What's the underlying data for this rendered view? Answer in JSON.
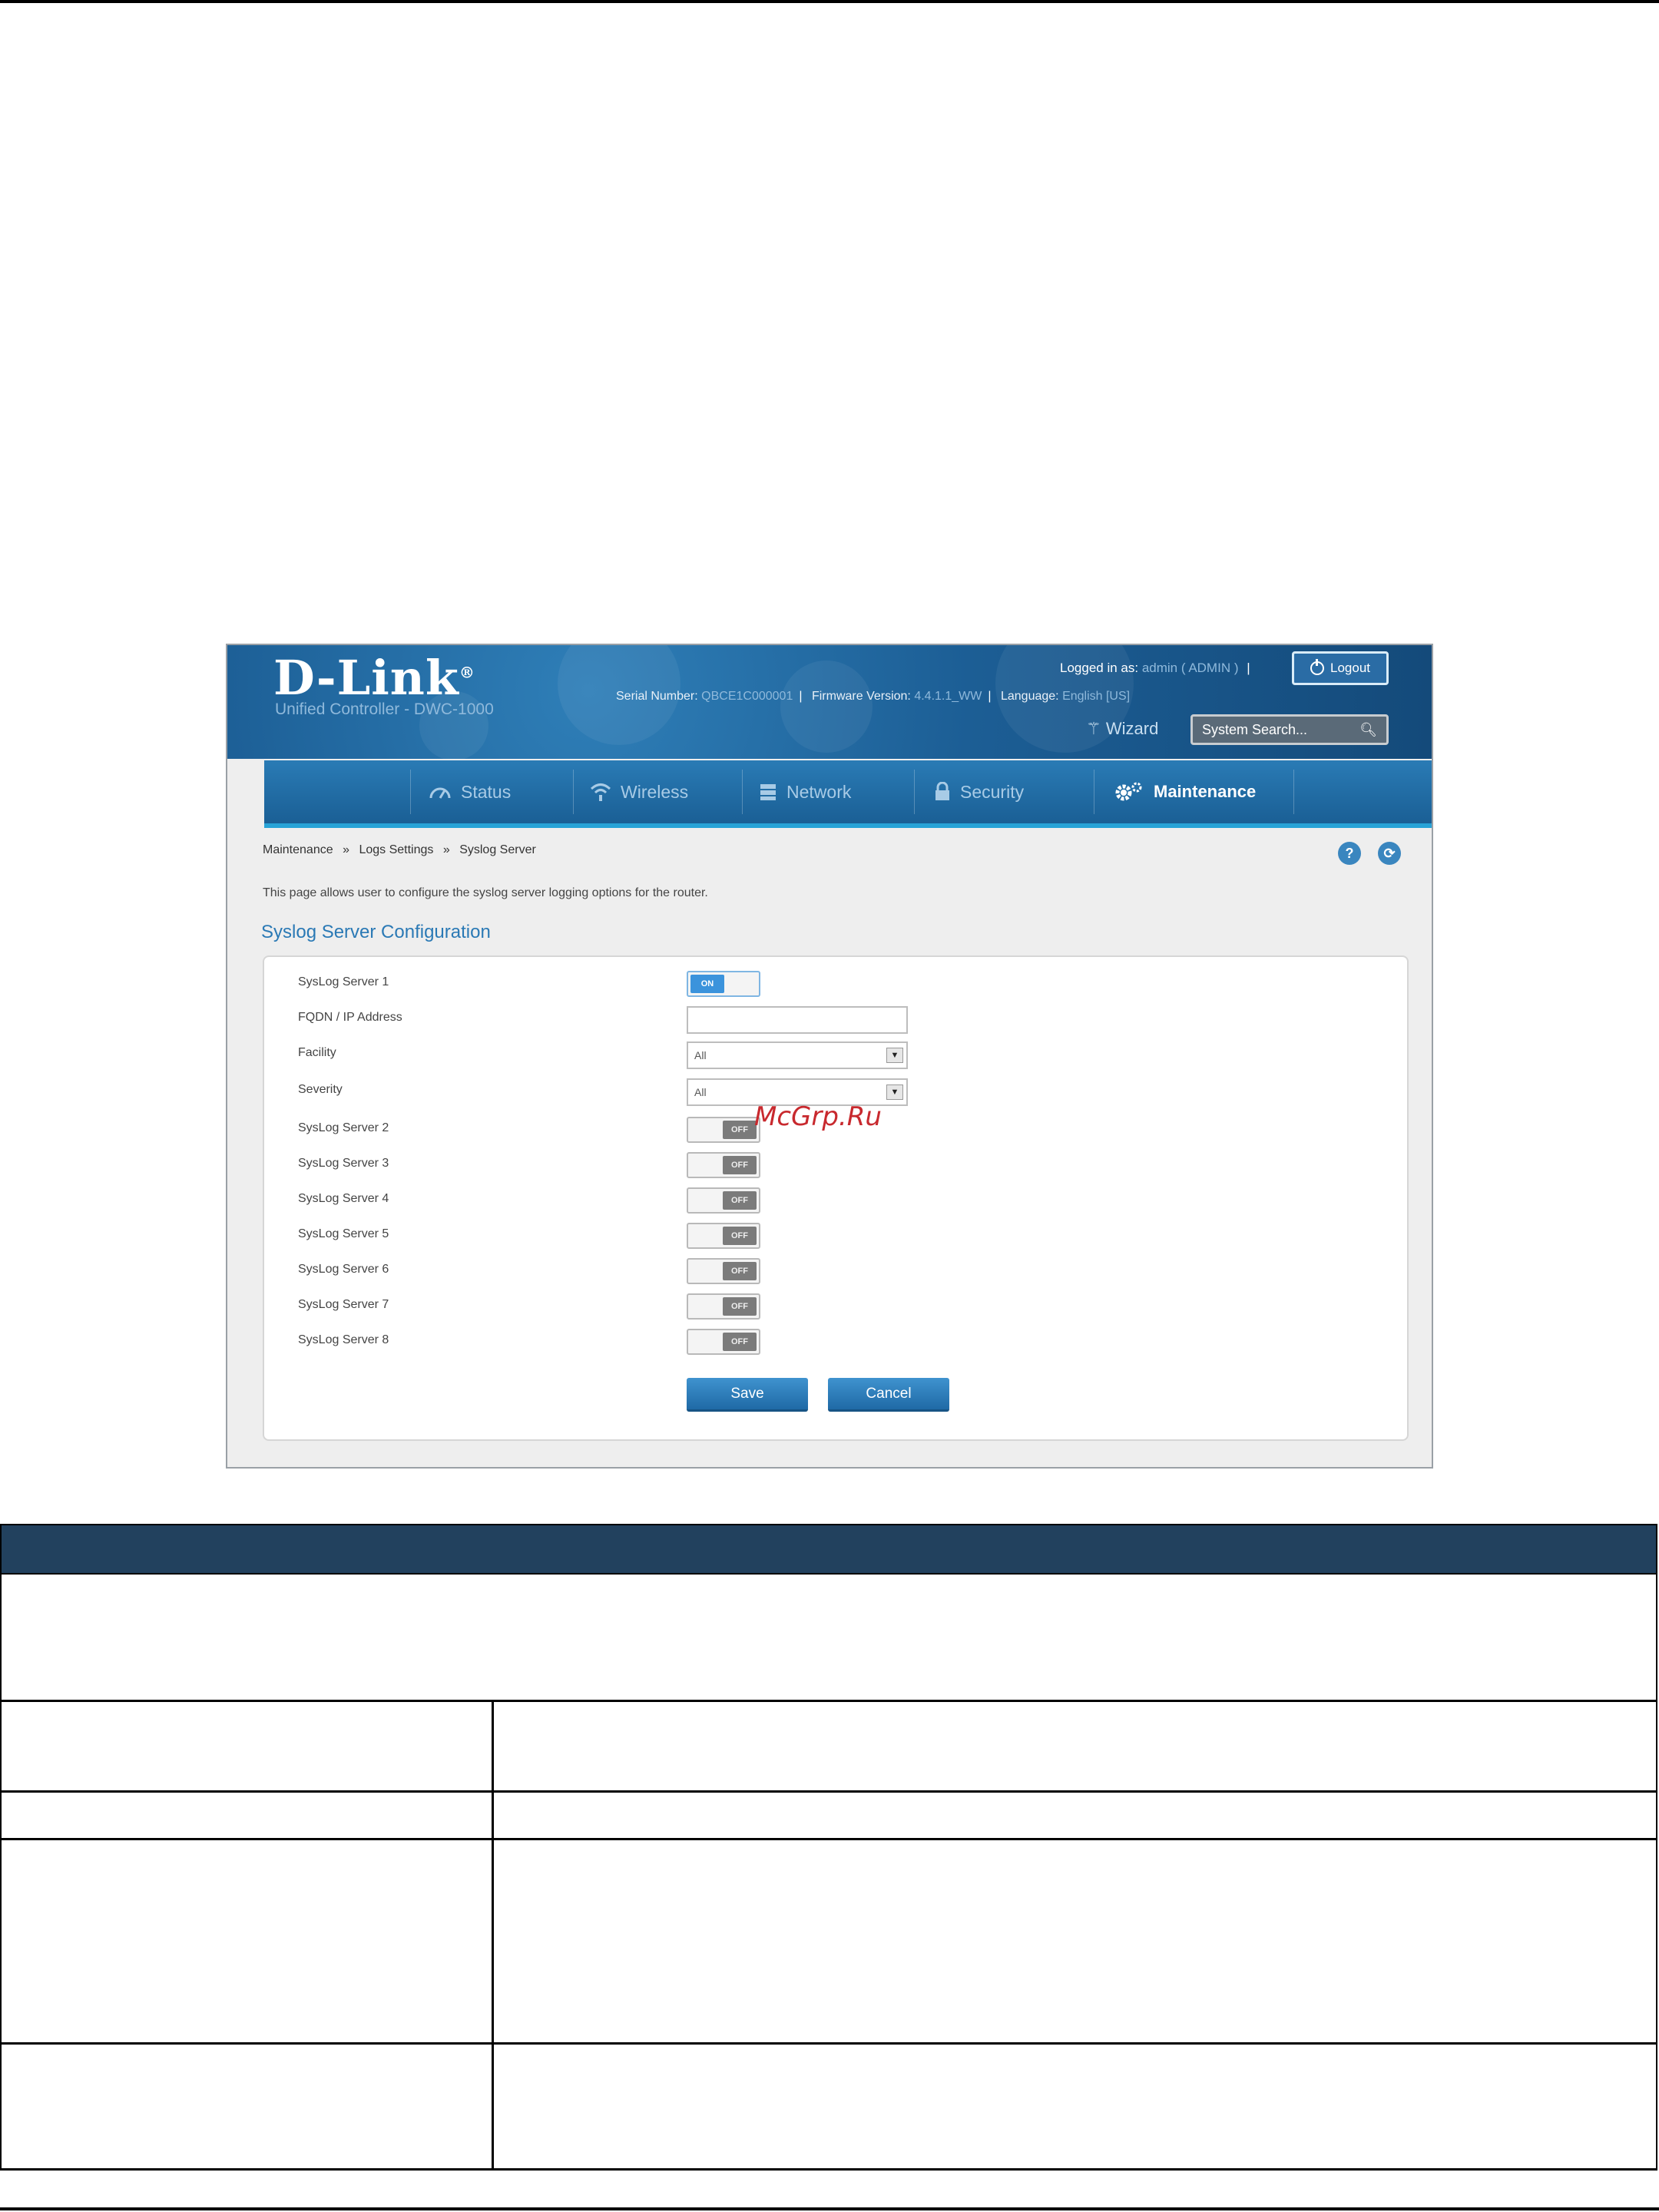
{
  "app": {
    "logo": "D-Link",
    "subtitle": "Unified Controller - DWC-1000",
    "serial_label": "Serial Number:",
    "serial_value": "QBCE1C000001",
    "firmware_label": "Firmware Version:",
    "firmware_value": "4.4.1.1_WW",
    "language_label": "Language:",
    "language_value": "English [US]",
    "logged_in_label": "Logged in as:",
    "logged_in_user": "admin",
    "logged_in_role": "( ADMIN )",
    "logout_label": "Logout",
    "wizard_label": "Wizard",
    "search_placeholder": "System Search..."
  },
  "nav": {
    "items": [
      {
        "label": "Status",
        "icon": "gauge-icon"
      },
      {
        "label": "Wireless",
        "icon": "wifi-icon"
      },
      {
        "label": "Network",
        "icon": "network-icon"
      },
      {
        "label": "Security",
        "icon": "lock-icon"
      },
      {
        "label": "Maintenance",
        "icon": "gear-icon"
      }
    ]
  },
  "breadcrumb": [
    "Maintenance",
    "Logs Settings",
    "Syslog Server"
  ],
  "breadcrumb_sep": "»",
  "page": {
    "description": "This page allows user to configure the syslog server logging options for the router.",
    "section_title": "Syslog Server Configuration"
  },
  "form": {
    "server1_label": "SysLog Server 1",
    "server1_state": "ON",
    "fqdn_label": "FQDN / IP Address",
    "fqdn_value": "",
    "facility_label": "Facility",
    "facility_value": "All",
    "severity_label": "Severity",
    "severity_value": "All",
    "off_label": "OFF",
    "servers": [
      {
        "label": "SysLog Server 2"
      },
      {
        "label": "SysLog Server 3"
      },
      {
        "label": "SysLog Server 4"
      },
      {
        "label": "SysLog Server 5"
      },
      {
        "label": "SysLog Server 6"
      },
      {
        "label": "SysLog Server 7"
      },
      {
        "label": "SysLog Server 8"
      }
    ],
    "save_label": "Save",
    "cancel_label": "Cancel"
  },
  "watermark": "McGrp.Ru",
  "colors": {
    "banner": "#1c5e95",
    "accent": "#2a79b5",
    "table_header": "#22415e"
  }
}
